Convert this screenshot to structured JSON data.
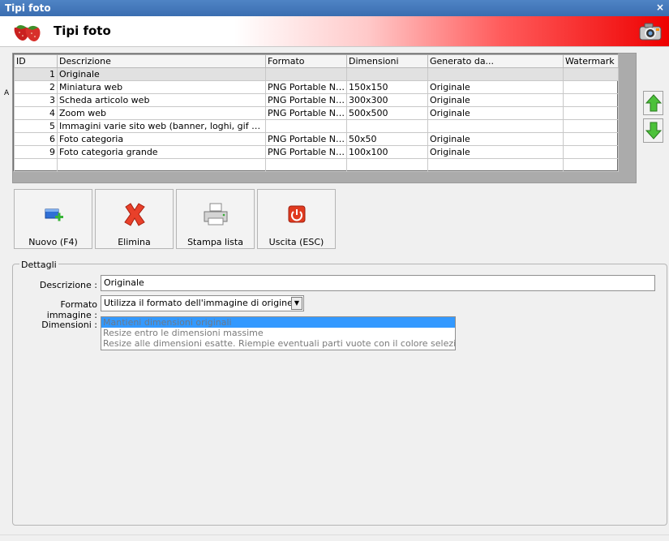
{
  "window": {
    "title": "Tipi foto",
    "close_label": "×"
  },
  "header": {
    "title": "Tipi foto"
  },
  "table": {
    "columns": [
      "ID",
      "Descrizione",
      "Formato",
      "Dimensioni",
      "Generato da...",
      "Watermark"
    ],
    "rows": [
      {
        "id": "1",
        "desc": "Originale",
        "formato": "",
        "dim": "",
        "gen": "",
        "wm": ""
      },
      {
        "id": "2",
        "desc": "Miniatura web",
        "formato": "PNG Portable Network Graphics",
        "dim": "150x150",
        "gen": "Originale",
        "wm": ""
      },
      {
        "id": "3",
        "desc": "Scheda articolo web",
        "formato": "PNG Portable Network Graphics",
        "dim": "300x300",
        "gen": "Originale",
        "wm": ""
      },
      {
        "id": "4",
        "desc": "Zoom web",
        "formato": "PNG Portable Network Graphics",
        "dim": "500x500",
        "gen": "Originale",
        "wm": ""
      },
      {
        "id": "5",
        "desc": "Immagini varie sito web (banner, loghi, gif animate)",
        "formato": "",
        "dim": "",
        "gen": "",
        "wm": ""
      },
      {
        "id": "6",
        "desc": "Foto categoria",
        "formato": "PNG Portable Network Graphics",
        "dim": "50x50",
        "gen": "Originale",
        "wm": ""
      },
      {
        "id": "9",
        "desc": "Foto categoria grande",
        "formato": "PNG Portable Network Graphics",
        "dim": "100x100",
        "gen": "Originale",
        "wm": ""
      }
    ]
  },
  "toolbar": {
    "new_label": "Nuovo (F4)",
    "delete_label": "Elimina",
    "print_label": "Stampa lista",
    "exit_label": "Uscita (ESC)"
  },
  "details": {
    "legend": "Dettagli",
    "descrizione_label": "Descrizione :",
    "descrizione_value": "Originale",
    "formato_label": "Formato immagine :",
    "formato_value": "Utilizza il formato dell'immagine di origine",
    "dimensioni_label": "Dimensioni :",
    "dimensioni_options": [
      "Mantieni dimensioni originali",
      "Resize entro le dimensioni massime",
      "Resize alle dimensioni esatte. Riempie eventuali parti vuote con il colore selezionato."
    ]
  },
  "misc": {
    "stray_char": "A"
  }
}
